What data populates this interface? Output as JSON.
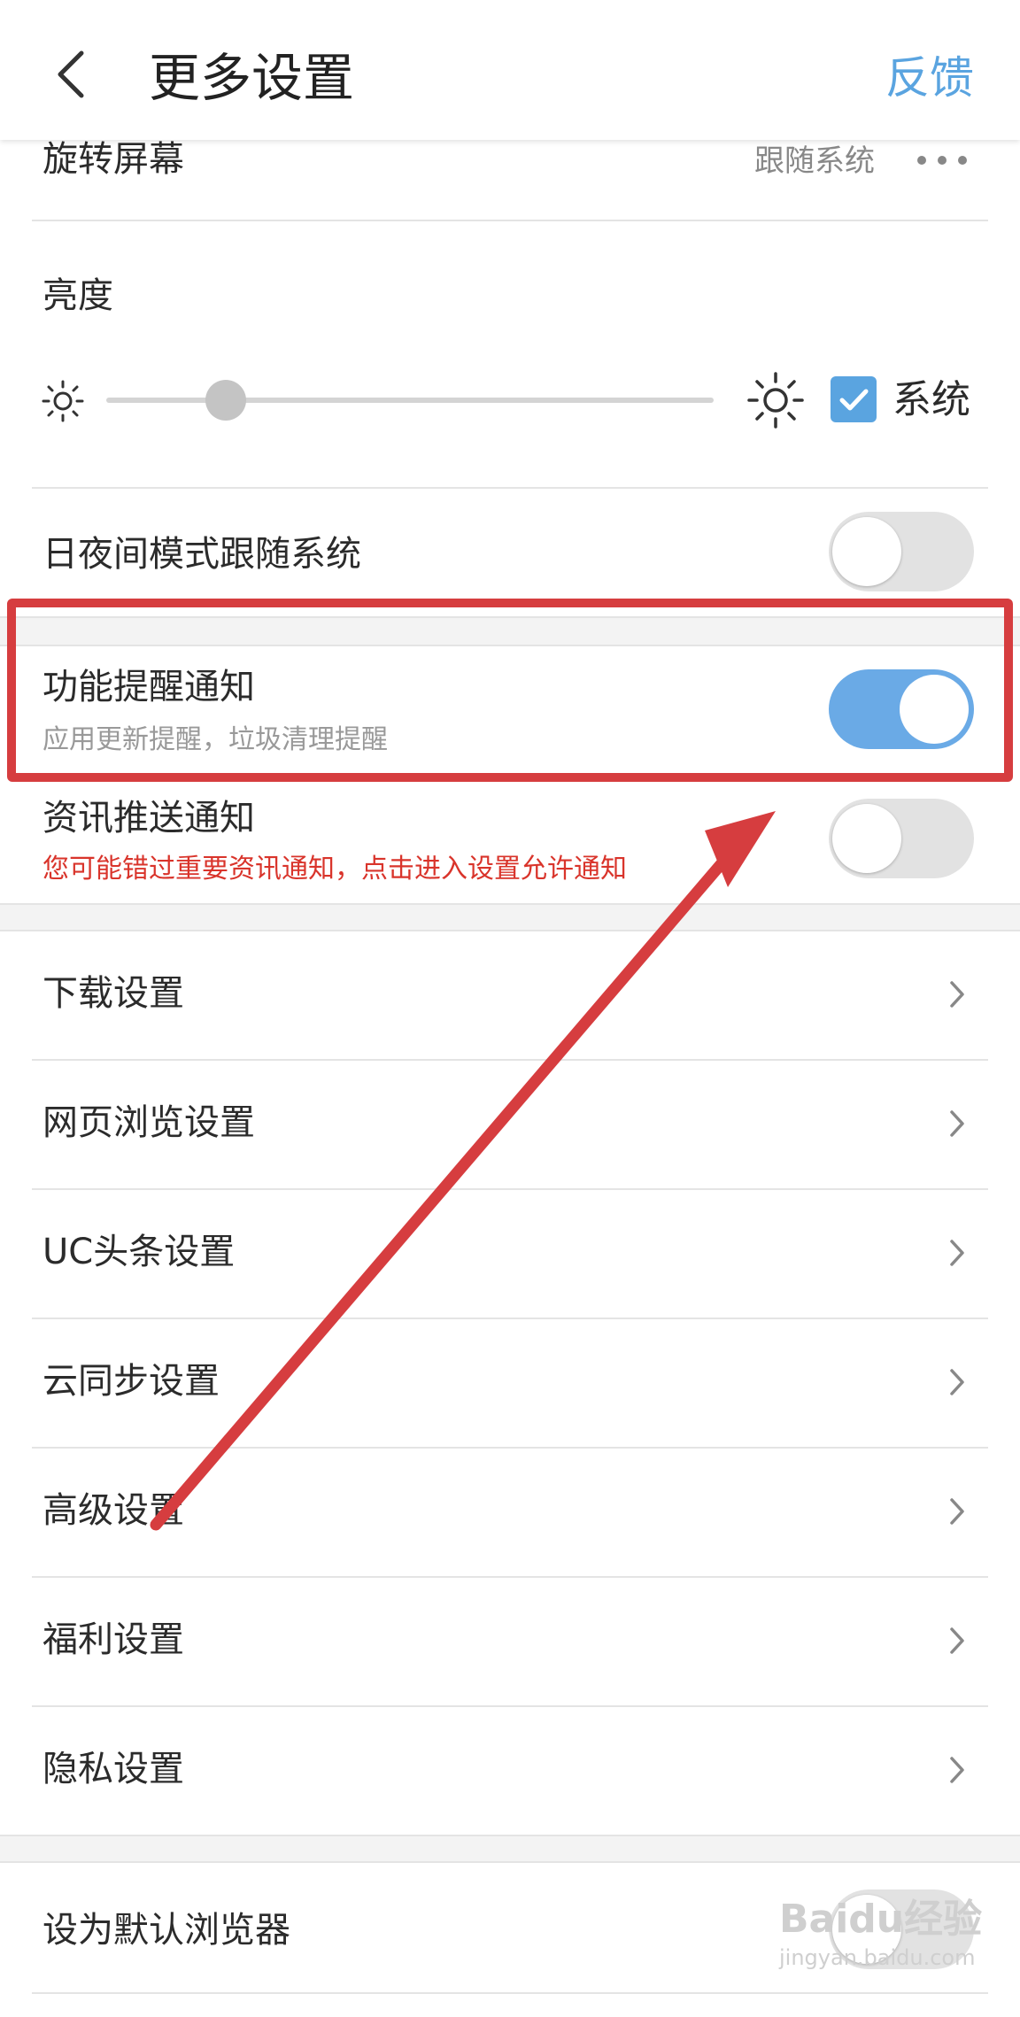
{
  "header": {
    "title": "更多设置",
    "feedback_label": "反馈"
  },
  "rotate": {
    "label": "旋转屏幕",
    "value": "跟随系统"
  },
  "brightness": {
    "label": "亮度",
    "level": 0.2,
    "system_checked": true,
    "system_label": "系统"
  },
  "night_mode": {
    "label": "日夜间模式跟随系统",
    "enabled": false
  },
  "feature_notify": {
    "label": "功能提醒通知",
    "sub": "应用更新提醒，垃圾清理提醒",
    "enabled": true
  },
  "news_notify": {
    "label": "资讯推送通知",
    "warning": "您可能错过重要资讯通知，点击进入设置允许通知",
    "enabled": false
  },
  "menu": [
    {
      "label": "下载设置"
    },
    {
      "label": "网页浏览设置"
    },
    {
      "label": "UC头条设置"
    },
    {
      "label": "云同步设置"
    },
    {
      "label": "高级设置"
    },
    {
      "label": "福利设置"
    },
    {
      "label": "隐私设置"
    }
  ],
  "default_browser": {
    "label": "设为默认浏览器",
    "enabled": false
  },
  "watermark": {
    "text": "Baidu经验",
    "sub": "jingyan.baidu.com"
  },
  "colors": {
    "accent": "#5aa4e0",
    "toggle_on": "#6aaae6",
    "highlight": "#d63d3f",
    "warning": "#d9342b"
  }
}
